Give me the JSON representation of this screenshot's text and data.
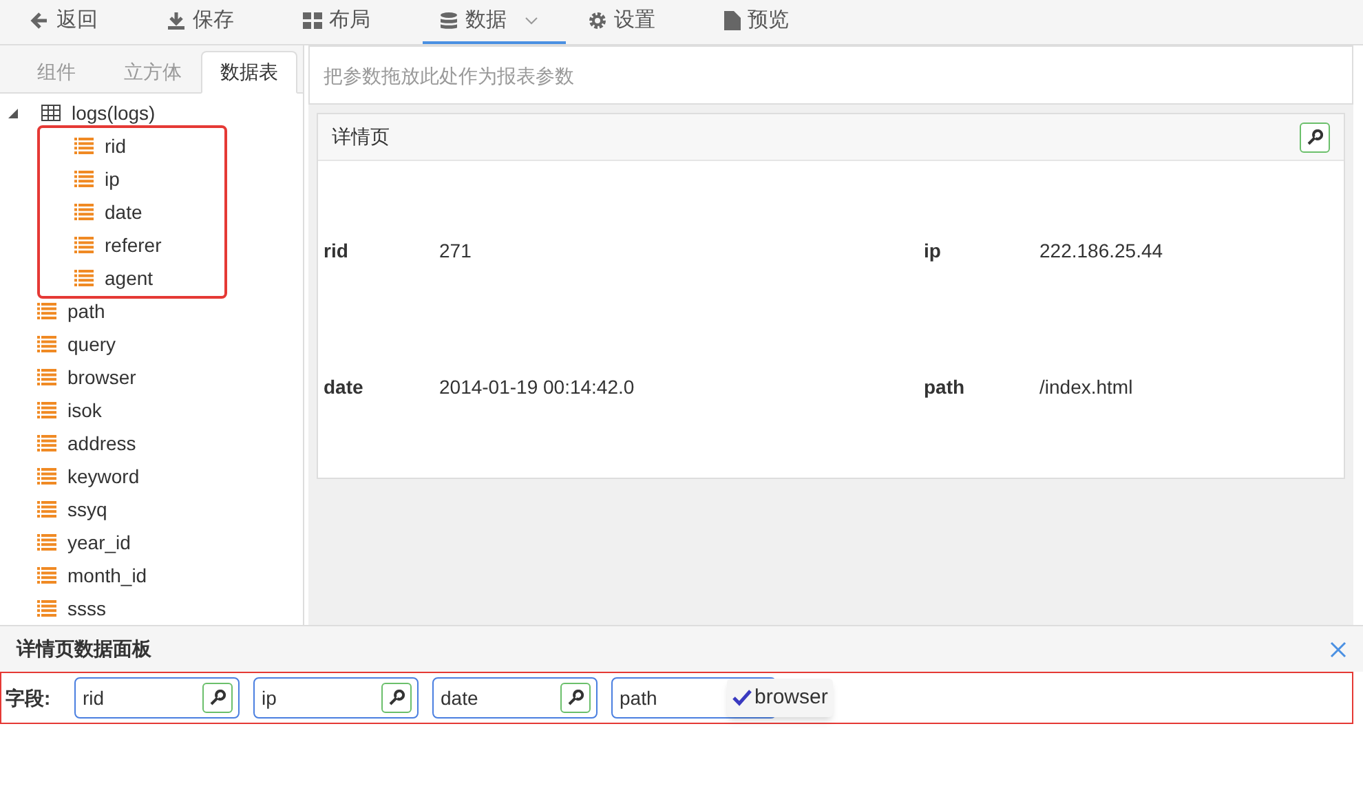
{
  "toolbar": [
    {
      "label": "返回",
      "selected": false
    },
    {
      "label": "保存",
      "selected": false
    },
    {
      "label": "布局",
      "selected": false
    },
    {
      "label": "数据",
      "selected": true,
      "dropdown": true
    },
    {
      "label": "设置",
      "selected": false
    },
    {
      "label": "预览",
      "selected": false
    }
  ],
  "side_tabs": [
    {
      "label": "组件",
      "selected": false
    },
    {
      "label": "立方体",
      "selected": false
    },
    {
      "label": "数据表",
      "selected": true
    }
  ],
  "tree": {
    "label": "logs(logs)",
    "expanded": true,
    "children": [
      {
        "label": "rid",
        "highlighted": true
      },
      {
        "label": "ip",
        "highlighted": true
      },
      {
        "label": "date",
        "highlighted": true
      },
      {
        "label": "referer",
        "highlighted": true
      },
      {
        "label": "agent",
        "highlighted": true
      },
      {
        "label": "path",
        "highlighted": false
      },
      {
        "label": "query",
        "highlighted": false
      },
      {
        "label": "browser",
        "highlighted": false
      },
      {
        "label": "isok",
        "highlighted": false
      },
      {
        "label": "address",
        "highlighted": false
      },
      {
        "label": "keyword",
        "highlighted": false
      },
      {
        "label": "ssyq",
        "highlighted": false
      },
      {
        "label": "year_id",
        "highlighted": false
      },
      {
        "label": "month_id",
        "highlighted": false
      },
      {
        "label": "ssss",
        "highlighted": false
      }
    ]
  },
  "param_drop": {
    "placeholder": "把参数拖放此处作为报表参数"
  },
  "detail": {
    "title": "详情页",
    "rows": [
      [
        {
          "label": "rid",
          "value": "271"
        },
        {
          "label": "ip",
          "value": "222.186.25.44"
        }
      ],
      [
        {
          "label": "date",
          "value": "2014-01-19 00:14:42.0"
        },
        {
          "label": "path",
          "value": "/index.html"
        }
      ]
    ]
  },
  "data_panel": {
    "title": "详情页数据面板",
    "fields_label": "字段:",
    "fields": [
      "rid",
      "ip",
      "date",
      "path"
    ],
    "drag_item": {
      "label": "browser"
    }
  }
}
